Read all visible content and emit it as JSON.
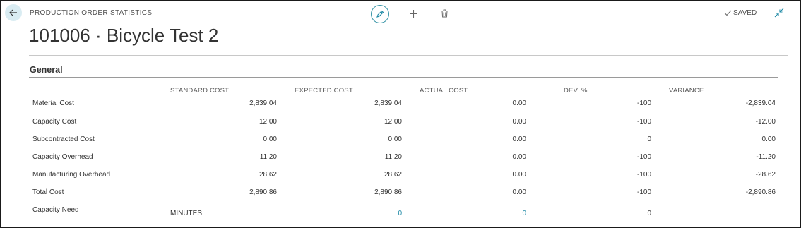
{
  "page": {
    "caption": "PRODUCTION ORDER STATISTICS",
    "title": "101006 · Bicycle Test 2",
    "saved_label": "SAVED"
  },
  "icons": {
    "back": "arrow-left-icon",
    "edit": "pencil-icon",
    "add": "plus-icon",
    "delete": "trash-icon",
    "saved": "checkmark-icon",
    "collapse": "collapse-icon"
  },
  "colors": {
    "accent": "#1f8aa6",
    "back_bg": "#d9ecf2"
  },
  "section": {
    "title": "General",
    "columns": [
      "STANDARD COST",
      "EXPECTED COST",
      "ACTUAL COST",
      "DEV. %",
      "VARIANCE"
    ],
    "rows": [
      {
        "label": "Material Cost",
        "standard": "2,839.04",
        "expected": "2,839.04",
        "actual": "0.00",
        "dev": "-100",
        "variance": "-2,839.04"
      },
      {
        "label": "Capacity Cost",
        "standard": "12.00",
        "expected": "12.00",
        "actual": "0.00",
        "dev": "-100",
        "variance": "-12.00"
      },
      {
        "label": "Subcontracted Cost",
        "standard": "0.00",
        "expected": "0.00",
        "actual": "0.00",
        "dev": "0",
        "variance": "0.00"
      },
      {
        "label": "Capacity Overhead",
        "standard": "11.20",
        "expected": "11.20",
        "actual": "0.00",
        "dev": "-100",
        "variance": "-11.20"
      },
      {
        "label": "Manufacturing Overhead",
        "standard": "28.62",
        "expected": "28.62",
        "actual": "0.00",
        "dev": "-100",
        "variance": "-28.62"
      },
      {
        "label": "Total Cost",
        "standard": "2,890.86",
        "expected": "2,890.86",
        "actual": "0.00",
        "dev": "-100",
        "variance": "-2,890.86"
      }
    ],
    "capacity_need": {
      "label": "Capacity Need",
      "unit": "MINUTES",
      "expected": "0",
      "actual": "0",
      "dev": "0"
    }
  }
}
